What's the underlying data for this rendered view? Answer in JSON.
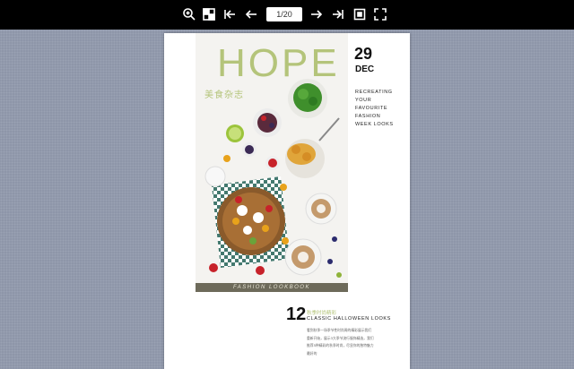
{
  "toolbar": {
    "page_indicator": "1/20",
    "buttons": [
      {
        "name": "zoom-in-button",
        "icon": "zoom-in-icon"
      },
      {
        "name": "thumbnails-button",
        "icon": "grid-icon"
      },
      {
        "name": "first-page-button",
        "icon": "first-page-icon"
      },
      {
        "name": "prev-page-button",
        "icon": "arrow-left-icon"
      },
      {
        "name": "next-page-button",
        "icon": "arrow-right-icon"
      },
      {
        "name": "last-page-button",
        "icon": "last-page-icon"
      },
      {
        "name": "fit-page-button",
        "icon": "fit-icon"
      },
      {
        "name": "fullscreen-button",
        "icon": "fullscreen-icon"
      }
    ]
  },
  "magazine": {
    "title": "HOPE",
    "subtitle_cn": "美食杂志",
    "date_day": "29",
    "date_month": "DEC",
    "tagline": [
      "RECREATING",
      "YOUR",
      "FAVOURITE",
      "FASHION",
      "WEEK LOOKS"
    ],
    "caption": "FASHION LOOKBOOK",
    "issue_number": "12",
    "issue_cn": "秋季时尚精彩",
    "issue_en": "CLASSIC HALLOWEEN LOOKS",
    "body_text": [
      "看到秋季一场季节性时尚周的精彩展示我们",
      "重新开始，展示3大季节流行服饰精选，我们",
      "推荐5种精彩的秋季时尚，尽显你的独特魅力",
      "最好的"
    ]
  },
  "colors": {
    "accent_green": "#b4c47a",
    "toolbar_bg": "#000000",
    "viewer_bg": "#8e96a9"
  }
}
